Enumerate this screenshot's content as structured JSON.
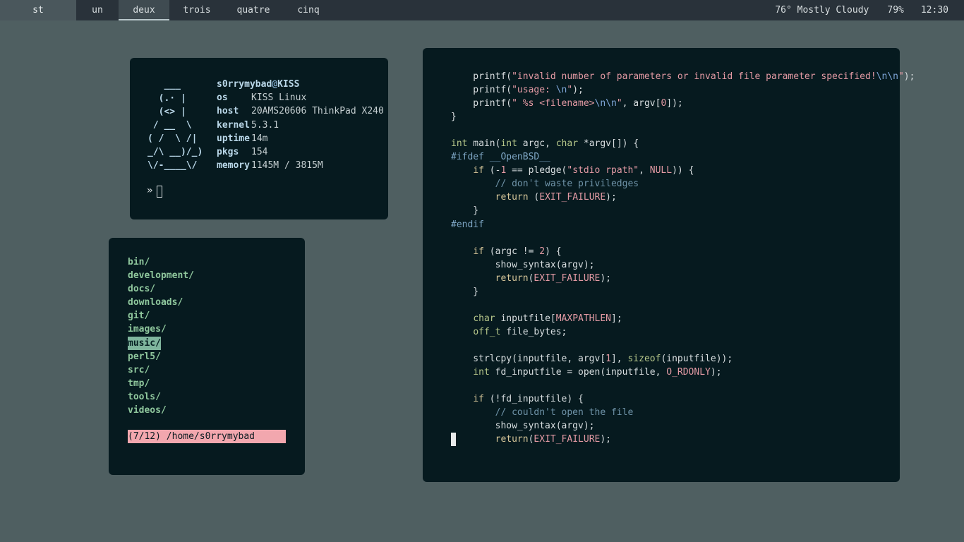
{
  "bar": {
    "title": "st",
    "tabs": [
      {
        "label": "un",
        "active": false
      },
      {
        "label": "deux",
        "active": true
      },
      {
        "label": "trois",
        "active": false
      },
      {
        "label": "quatre",
        "active": false
      },
      {
        "label": "cinq",
        "active": false
      }
    ],
    "weather": "76° Mostly Cloudy",
    "battery": "79%",
    "clock": "12:30"
  },
  "fetch": {
    "ascii": "   ___\n  (.· |\n  (<> |\n / __  \\\n( /  \\ /|\n_/\\ __)/_)\n\\/-____\\/",
    "user": "s0rrymybad",
    "at": "@",
    "host": "KISS",
    "fields": [
      {
        "key": "os",
        "value": "KISS Linux"
      },
      {
        "key": "host",
        "value": "20AMS20606 ThinkPad X240"
      },
      {
        "key": "kernel",
        "value": "5.3.1"
      },
      {
        "key": "uptime",
        "value": "14m"
      },
      {
        "key": "pkgs",
        "value": "154"
      },
      {
        "key": "memory",
        "value": "1145M / 3815M"
      }
    ],
    "prompt": "»"
  },
  "files": {
    "items": [
      "bin/",
      "development/",
      "docs/",
      "downloads/",
      "git/",
      "images/",
      "music/",
      "perl5/",
      "src/",
      "tmp/",
      "tools/",
      "videos/"
    ],
    "selected": "music/",
    "status": "(7/12) /home/s0rrymybad"
  },
  "editor": {
    "lines": [
      "    printf(\"invalid number of parameters or invalid file parameter specified!\\n\\n\");",
      "    printf(\"usage: \\n\");",
      "    printf(\" %s <filename>\\n\\n\", argv[0]);",
      "}",
      "",
      "int main(int argc, char *argv[]) {",
      "#ifdef __OpenBSD__",
      "    if (-1 == pledge(\"stdio rpath\", NULL)) {",
      "        // don't waste priviledges",
      "        return (EXIT_FAILURE);",
      "    }",
      "#endif",
      "",
      "    if (argc != 2) {",
      "        show_syntax(argv);",
      "        return(EXIT_FAILURE);",
      "    }",
      "",
      "    char inputfile[MAXPATHLEN];",
      "    off_t file_bytes;",
      "",
      "    strlcpy(inputfile, argv[1], sizeof(inputfile));",
      "    int fd_inputfile = open(inputfile, O_RDONLY);",
      "",
      "    if (!fd_inputfile) {",
      "        // couldn't open the file",
      "        show_syntax(argv);",
      "        return(EXIT_FAILURE);"
    ]
  }
}
